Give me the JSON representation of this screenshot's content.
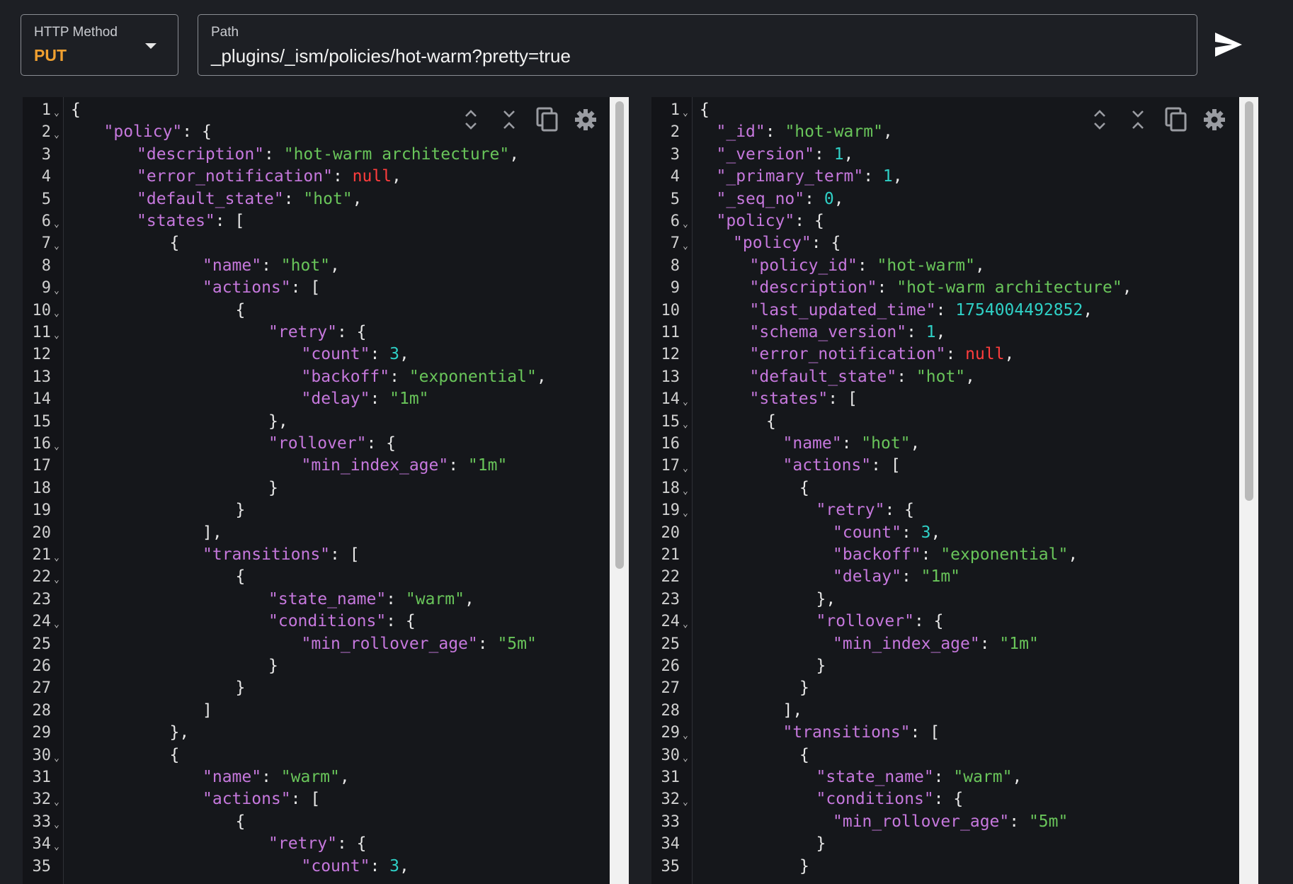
{
  "method": {
    "label": "HTTP Method",
    "value": "PUT"
  },
  "path": {
    "label": "Path",
    "value": "_plugins/_ism/policies/hot-warm?pretty=true"
  },
  "icons": {
    "send": "send-icon",
    "expand": "expand-all-icon",
    "collapse": "collapse-all-icon",
    "copy": "copy-icon",
    "settings": "gear-icon"
  },
  "colors": {
    "key": "#c678dd",
    "string": "#69c55a",
    "number": "#2fd0c6",
    "null": "#ff3d3d",
    "method": "#f0a030"
  },
  "request_editor": {
    "lines": [
      {
        "n": "1",
        "fold": true,
        "indent": 0,
        "tokens": [
          [
            "p",
            "{"
          ]
        ]
      },
      {
        "n": "2",
        "fold": true,
        "indent": 1,
        "tokens": [
          [
            "k",
            "\"policy\""
          ],
          [
            "p",
            ": {"
          ]
        ]
      },
      {
        "n": "3",
        "fold": false,
        "indent": 2,
        "tokens": [
          [
            "k",
            "\"description\""
          ],
          [
            "p",
            ": "
          ],
          [
            "s",
            "\"hot-warm architecture\""
          ],
          [
            "p",
            ","
          ]
        ]
      },
      {
        "n": "4",
        "fold": false,
        "indent": 2,
        "tokens": [
          [
            "k",
            "\"error_notification\""
          ],
          [
            "p",
            ": "
          ],
          [
            "nl",
            "null"
          ],
          [
            "p",
            ","
          ]
        ]
      },
      {
        "n": "5",
        "fold": false,
        "indent": 2,
        "tokens": [
          [
            "k",
            "\"default_state\""
          ],
          [
            "p",
            ": "
          ],
          [
            "s",
            "\"hot\""
          ],
          [
            "p",
            ","
          ]
        ]
      },
      {
        "n": "6",
        "fold": true,
        "indent": 2,
        "tokens": [
          [
            "k",
            "\"states\""
          ],
          [
            "p",
            ": ["
          ]
        ]
      },
      {
        "n": "7",
        "fold": true,
        "indent": 3,
        "tokens": [
          [
            "p",
            "{"
          ]
        ]
      },
      {
        "n": "8",
        "fold": false,
        "indent": 4,
        "tokens": [
          [
            "k",
            "\"name\""
          ],
          [
            "p",
            ": "
          ],
          [
            "s",
            "\"hot\""
          ],
          [
            "p",
            ","
          ]
        ]
      },
      {
        "n": "9",
        "fold": true,
        "indent": 4,
        "tokens": [
          [
            "k",
            "\"actions\""
          ],
          [
            "p",
            ": ["
          ]
        ]
      },
      {
        "n": "10",
        "fold": true,
        "indent": 5,
        "tokens": [
          [
            "p",
            "{"
          ]
        ]
      },
      {
        "n": "11",
        "fold": true,
        "indent": 6,
        "tokens": [
          [
            "k",
            "\"retry\""
          ],
          [
            "p",
            ": {"
          ]
        ]
      },
      {
        "n": "12",
        "fold": false,
        "indent": 7,
        "tokens": [
          [
            "k",
            "\"count\""
          ],
          [
            "p",
            ": "
          ],
          [
            "n",
            "3"
          ],
          [
            "p",
            ","
          ]
        ]
      },
      {
        "n": "13",
        "fold": false,
        "indent": 7,
        "tokens": [
          [
            "k",
            "\"backoff\""
          ],
          [
            "p",
            ": "
          ],
          [
            "s",
            "\"exponential\""
          ],
          [
            "p",
            ","
          ]
        ]
      },
      {
        "n": "14",
        "fold": false,
        "indent": 7,
        "tokens": [
          [
            "k",
            "\"delay\""
          ],
          [
            "p",
            ": "
          ],
          [
            "s",
            "\"1m\""
          ]
        ]
      },
      {
        "n": "15",
        "fold": false,
        "indent": 6,
        "tokens": [
          [
            "p",
            "},"
          ]
        ]
      },
      {
        "n": "16",
        "fold": true,
        "indent": 6,
        "tokens": [
          [
            "k",
            "\"rollover\""
          ],
          [
            "p",
            ": {"
          ]
        ]
      },
      {
        "n": "17",
        "fold": false,
        "indent": 7,
        "tokens": [
          [
            "k",
            "\"min_index_age\""
          ],
          [
            "p",
            ": "
          ],
          [
            "s",
            "\"1m\""
          ]
        ]
      },
      {
        "n": "18",
        "fold": false,
        "indent": 6,
        "tokens": [
          [
            "p",
            "}"
          ]
        ]
      },
      {
        "n": "19",
        "fold": false,
        "indent": 5,
        "tokens": [
          [
            "p",
            "}"
          ]
        ]
      },
      {
        "n": "20",
        "fold": false,
        "indent": 4,
        "tokens": [
          [
            "p",
            "],"
          ]
        ]
      },
      {
        "n": "21",
        "fold": true,
        "indent": 4,
        "tokens": [
          [
            "k",
            "\"transitions\""
          ],
          [
            "p",
            ": ["
          ]
        ]
      },
      {
        "n": "22",
        "fold": true,
        "indent": 5,
        "tokens": [
          [
            "p",
            "{"
          ]
        ]
      },
      {
        "n": "23",
        "fold": false,
        "indent": 6,
        "tokens": [
          [
            "k",
            "\"state_name\""
          ],
          [
            "p",
            ": "
          ],
          [
            "s",
            "\"warm\""
          ],
          [
            "p",
            ","
          ]
        ]
      },
      {
        "n": "24",
        "fold": true,
        "indent": 6,
        "tokens": [
          [
            "k",
            "\"conditions\""
          ],
          [
            "p",
            ": {"
          ]
        ]
      },
      {
        "n": "25",
        "fold": false,
        "indent": 7,
        "tokens": [
          [
            "k",
            "\"min_rollover_age\""
          ],
          [
            "p",
            ": "
          ],
          [
            "s",
            "\"5m\""
          ]
        ]
      },
      {
        "n": "26",
        "fold": false,
        "indent": 6,
        "tokens": [
          [
            "p",
            "}"
          ]
        ]
      },
      {
        "n": "27",
        "fold": false,
        "indent": 5,
        "tokens": [
          [
            "p",
            "}"
          ]
        ]
      },
      {
        "n": "28",
        "fold": false,
        "indent": 4,
        "tokens": [
          [
            "p",
            "]"
          ]
        ]
      },
      {
        "n": "29",
        "fold": false,
        "indent": 3,
        "tokens": [
          [
            "p",
            "},"
          ]
        ]
      },
      {
        "n": "30",
        "fold": true,
        "indent": 3,
        "tokens": [
          [
            "p",
            "{"
          ]
        ]
      },
      {
        "n": "31",
        "fold": false,
        "indent": 4,
        "tokens": [
          [
            "k",
            "\"name\""
          ],
          [
            "p",
            ": "
          ],
          [
            "s",
            "\"warm\""
          ],
          [
            "p",
            ","
          ]
        ]
      },
      {
        "n": "32",
        "fold": true,
        "indent": 4,
        "tokens": [
          [
            "k",
            "\"actions\""
          ],
          [
            "p",
            ": ["
          ]
        ]
      },
      {
        "n": "33",
        "fold": true,
        "indent": 5,
        "tokens": [
          [
            "p",
            "{"
          ]
        ]
      },
      {
        "n": "34",
        "fold": true,
        "indent": 6,
        "tokens": [
          [
            "k",
            "\"retry\""
          ],
          [
            "p",
            ": {"
          ]
        ]
      },
      {
        "n": "35",
        "fold": false,
        "indent": 7,
        "tokens": [
          [
            "k",
            "\"count\""
          ],
          [
            "p",
            ": "
          ],
          [
            "n",
            "3"
          ],
          [
            "p",
            ","
          ]
        ]
      }
    ]
  },
  "response_editor": {
    "lines": [
      {
        "n": "1",
        "fold": true,
        "indent": 0,
        "tokens": [
          [
            "p",
            "{"
          ]
        ]
      },
      {
        "n": "2",
        "fold": false,
        "indent": 1,
        "tokens": [
          [
            "k",
            "\"_id\""
          ],
          [
            "p",
            ": "
          ],
          [
            "s",
            "\"hot-warm\""
          ],
          [
            "p",
            ","
          ]
        ]
      },
      {
        "n": "3",
        "fold": false,
        "indent": 1,
        "tokens": [
          [
            "k",
            "\"_version\""
          ],
          [
            "p",
            ": "
          ],
          [
            "n",
            "1"
          ],
          [
            "p",
            ","
          ]
        ]
      },
      {
        "n": "4",
        "fold": false,
        "indent": 1,
        "tokens": [
          [
            "k",
            "\"_primary_term\""
          ],
          [
            "p",
            ": "
          ],
          [
            "n",
            "1"
          ],
          [
            "p",
            ","
          ]
        ]
      },
      {
        "n": "5",
        "fold": false,
        "indent": 1,
        "tokens": [
          [
            "k",
            "\"_seq_no\""
          ],
          [
            "p",
            ": "
          ],
          [
            "n",
            "0"
          ],
          [
            "p",
            ","
          ]
        ]
      },
      {
        "n": "6",
        "fold": true,
        "indent": 1,
        "tokens": [
          [
            "k",
            "\"policy\""
          ],
          [
            "p",
            ": {"
          ]
        ]
      },
      {
        "n": "7",
        "fold": true,
        "indent": 2,
        "tokens": [
          [
            "k",
            "\"policy\""
          ],
          [
            "p",
            ": {"
          ]
        ]
      },
      {
        "n": "8",
        "fold": false,
        "indent": 3,
        "tokens": [
          [
            "k",
            "\"policy_id\""
          ],
          [
            "p",
            ": "
          ],
          [
            "s",
            "\"hot-warm\""
          ],
          [
            "p",
            ","
          ]
        ]
      },
      {
        "n": "9",
        "fold": false,
        "indent": 3,
        "tokens": [
          [
            "k",
            "\"description\""
          ],
          [
            "p",
            ": "
          ],
          [
            "s",
            "\"hot-warm architecture\""
          ],
          [
            "p",
            ","
          ]
        ]
      },
      {
        "n": "10",
        "fold": false,
        "indent": 3,
        "tokens": [
          [
            "k",
            "\"last_updated_time\""
          ],
          [
            "p",
            ": "
          ],
          [
            "n",
            "1754004492852"
          ],
          [
            "p",
            ","
          ]
        ]
      },
      {
        "n": "11",
        "fold": false,
        "indent": 3,
        "tokens": [
          [
            "k",
            "\"schema_version\""
          ],
          [
            "p",
            ": "
          ],
          [
            "n",
            "1"
          ],
          [
            "p",
            ","
          ]
        ]
      },
      {
        "n": "12",
        "fold": false,
        "indent": 3,
        "tokens": [
          [
            "k",
            "\"error_notification\""
          ],
          [
            "p",
            ": "
          ],
          [
            "nl",
            "null"
          ],
          [
            "p",
            ","
          ]
        ]
      },
      {
        "n": "13",
        "fold": false,
        "indent": 3,
        "tokens": [
          [
            "k",
            "\"default_state\""
          ],
          [
            "p",
            ": "
          ],
          [
            "s",
            "\"hot\""
          ],
          [
            "p",
            ","
          ]
        ]
      },
      {
        "n": "14",
        "fold": true,
        "indent": 3,
        "tokens": [
          [
            "k",
            "\"states\""
          ],
          [
            "p",
            ": ["
          ]
        ]
      },
      {
        "n": "15",
        "fold": true,
        "indent": 4,
        "tokens": [
          [
            "p",
            "{"
          ]
        ]
      },
      {
        "n": "16",
        "fold": false,
        "indent": 5,
        "tokens": [
          [
            "k",
            "\"name\""
          ],
          [
            "p",
            ": "
          ],
          [
            "s",
            "\"hot\""
          ],
          [
            "p",
            ","
          ]
        ]
      },
      {
        "n": "17",
        "fold": true,
        "indent": 5,
        "tokens": [
          [
            "k",
            "\"actions\""
          ],
          [
            "p",
            ": ["
          ]
        ]
      },
      {
        "n": "18",
        "fold": true,
        "indent": 6,
        "tokens": [
          [
            "p",
            "{"
          ]
        ]
      },
      {
        "n": "19",
        "fold": true,
        "indent": 7,
        "tokens": [
          [
            "k",
            "\"retry\""
          ],
          [
            "p",
            ": {"
          ]
        ]
      },
      {
        "n": "20",
        "fold": false,
        "indent": 8,
        "tokens": [
          [
            "k",
            "\"count\""
          ],
          [
            "p",
            ": "
          ],
          [
            "n",
            "3"
          ],
          [
            "p",
            ","
          ]
        ]
      },
      {
        "n": "21",
        "fold": false,
        "indent": 8,
        "tokens": [
          [
            "k",
            "\"backoff\""
          ],
          [
            "p",
            ": "
          ],
          [
            "s",
            "\"exponential\""
          ],
          [
            "p",
            ","
          ]
        ]
      },
      {
        "n": "22",
        "fold": false,
        "indent": 8,
        "tokens": [
          [
            "k",
            "\"delay\""
          ],
          [
            "p",
            ": "
          ],
          [
            "s",
            "\"1m\""
          ]
        ]
      },
      {
        "n": "23",
        "fold": false,
        "indent": 7,
        "tokens": [
          [
            "p",
            "},"
          ]
        ]
      },
      {
        "n": "24",
        "fold": true,
        "indent": 7,
        "tokens": [
          [
            "k",
            "\"rollover\""
          ],
          [
            "p",
            ": {"
          ]
        ]
      },
      {
        "n": "25",
        "fold": false,
        "indent": 8,
        "tokens": [
          [
            "k",
            "\"min_index_age\""
          ],
          [
            "p",
            ": "
          ],
          [
            "s",
            "\"1m\""
          ]
        ]
      },
      {
        "n": "26",
        "fold": false,
        "indent": 7,
        "tokens": [
          [
            "p",
            "}"
          ]
        ]
      },
      {
        "n": "27",
        "fold": false,
        "indent": 6,
        "tokens": [
          [
            "p",
            "}"
          ]
        ]
      },
      {
        "n": "28",
        "fold": false,
        "indent": 5,
        "tokens": [
          [
            "p",
            "],"
          ]
        ]
      },
      {
        "n": "29",
        "fold": true,
        "indent": 5,
        "tokens": [
          [
            "k",
            "\"transitions\""
          ],
          [
            "p",
            ": ["
          ]
        ]
      },
      {
        "n": "30",
        "fold": true,
        "indent": 6,
        "tokens": [
          [
            "p",
            "{"
          ]
        ]
      },
      {
        "n": "31",
        "fold": false,
        "indent": 7,
        "tokens": [
          [
            "k",
            "\"state_name\""
          ],
          [
            "p",
            ": "
          ],
          [
            "s",
            "\"warm\""
          ],
          [
            "p",
            ","
          ]
        ]
      },
      {
        "n": "32",
        "fold": true,
        "indent": 7,
        "tokens": [
          [
            "k",
            "\"conditions\""
          ],
          [
            "p",
            ": {"
          ]
        ]
      },
      {
        "n": "33",
        "fold": false,
        "indent": 8,
        "tokens": [
          [
            "k",
            "\"min_rollover_age\""
          ],
          [
            "p",
            ": "
          ],
          [
            "s",
            "\"5m\""
          ]
        ]
      },
      {
        "n": "34",
        "fold": false,
        "indent": 7,
        "tokens": [
          [
            "p",
            "}"
          ]
        ]
      },
      {
        "n": "35",
        "fold": false,
        "indent": 6,
        "tokens": [
          [
            "p",
            "}"
          ]
        ]
      }
    ]
  }
}
